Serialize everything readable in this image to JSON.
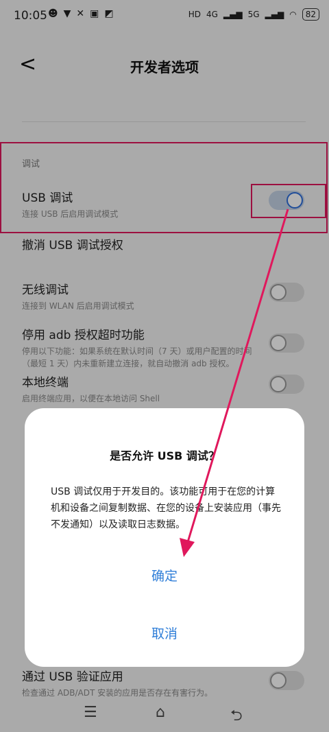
{
  "status": {
    "time": "10:05",
    "battery": "82",
    "network": "4G",
    "network2": "5G",
    "hd": "HD"
  },
  "header": {
    "back": "<",
    "title": "开发者选项"
  },
  "section": {
    "title": "调试"
  },
  "items": [
    {
      "title": "USB 调试",
      "subtitle": "连接 USB 后启用调试模式"
    },
    {
      "title": "撤消 USB 调试授权",
      "subtitle": ""
    },
    {
      "title": "无线调试",
      "subtitle": "连接到 WLAN 后启用调试模式"
    },
    {
      "title": "停用 adb 授权超时功能",
      "subtitle": "停用以下功能：如果系统在默认时间（7 天）或用户配置的时间（最短 1 天）内未重新建立连接，就自动撤消 adb 授权。"
    },
    {
      "title": "本地终端",
      "subtitle": "启用终端应用，以便在本地访问 Shell"
    },
    {
      "title": "通过 USB 验证应用",
      "subtitle": "检查通过 ADB/ADT 安装的应用是否存在有害行为。"
    }
  ],
  "dialog": {
    "title": "是否允许 USB 调试？",
    "body": "USB 调试仅用于开发目的。该功能可用于在您的计算机和设备之间复制数据、在您的设备上安装应用（事先不发通知）以及读取日志数据。",
    "confirm": "确定",
    "cancel": "取消"
  },
  "colors": {
    "accent": "#2f7ed8",
    "highlight": "#e0185c"
  }
}
